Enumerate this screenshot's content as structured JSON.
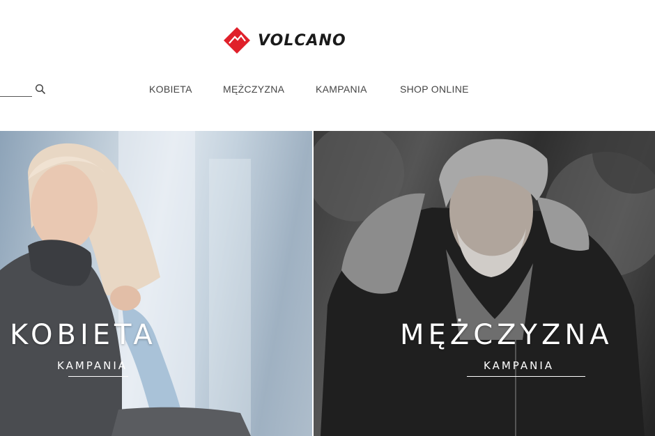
{
  "header": {
    "logo_text": "VOLCANO",
    "logo_color": "#e0202a",
    "search_placeholder": ""
  },
  "nav": {
    "items": [
      {
        "label": "KOBIETA"
      },
      {
        "label": "MĘŻCZYZNA"
      },
      {
        "label": "KAMPANIA"
      },
      {
        "label": "SHOP ONLINE"
      }
    ]
  },
  "panels": {
    "left": {
      "title": "KOBIETA",
      "subtitle": "KAMPANIA"
    },
    "right": {
      "title": "MĘŻCZYZNA",
      "subtitle": "KAMPANIA"
    }
  },
  "icons": {
    "search": "search-icon",
    "logo": "volcano-logo-icon"
  }
}
